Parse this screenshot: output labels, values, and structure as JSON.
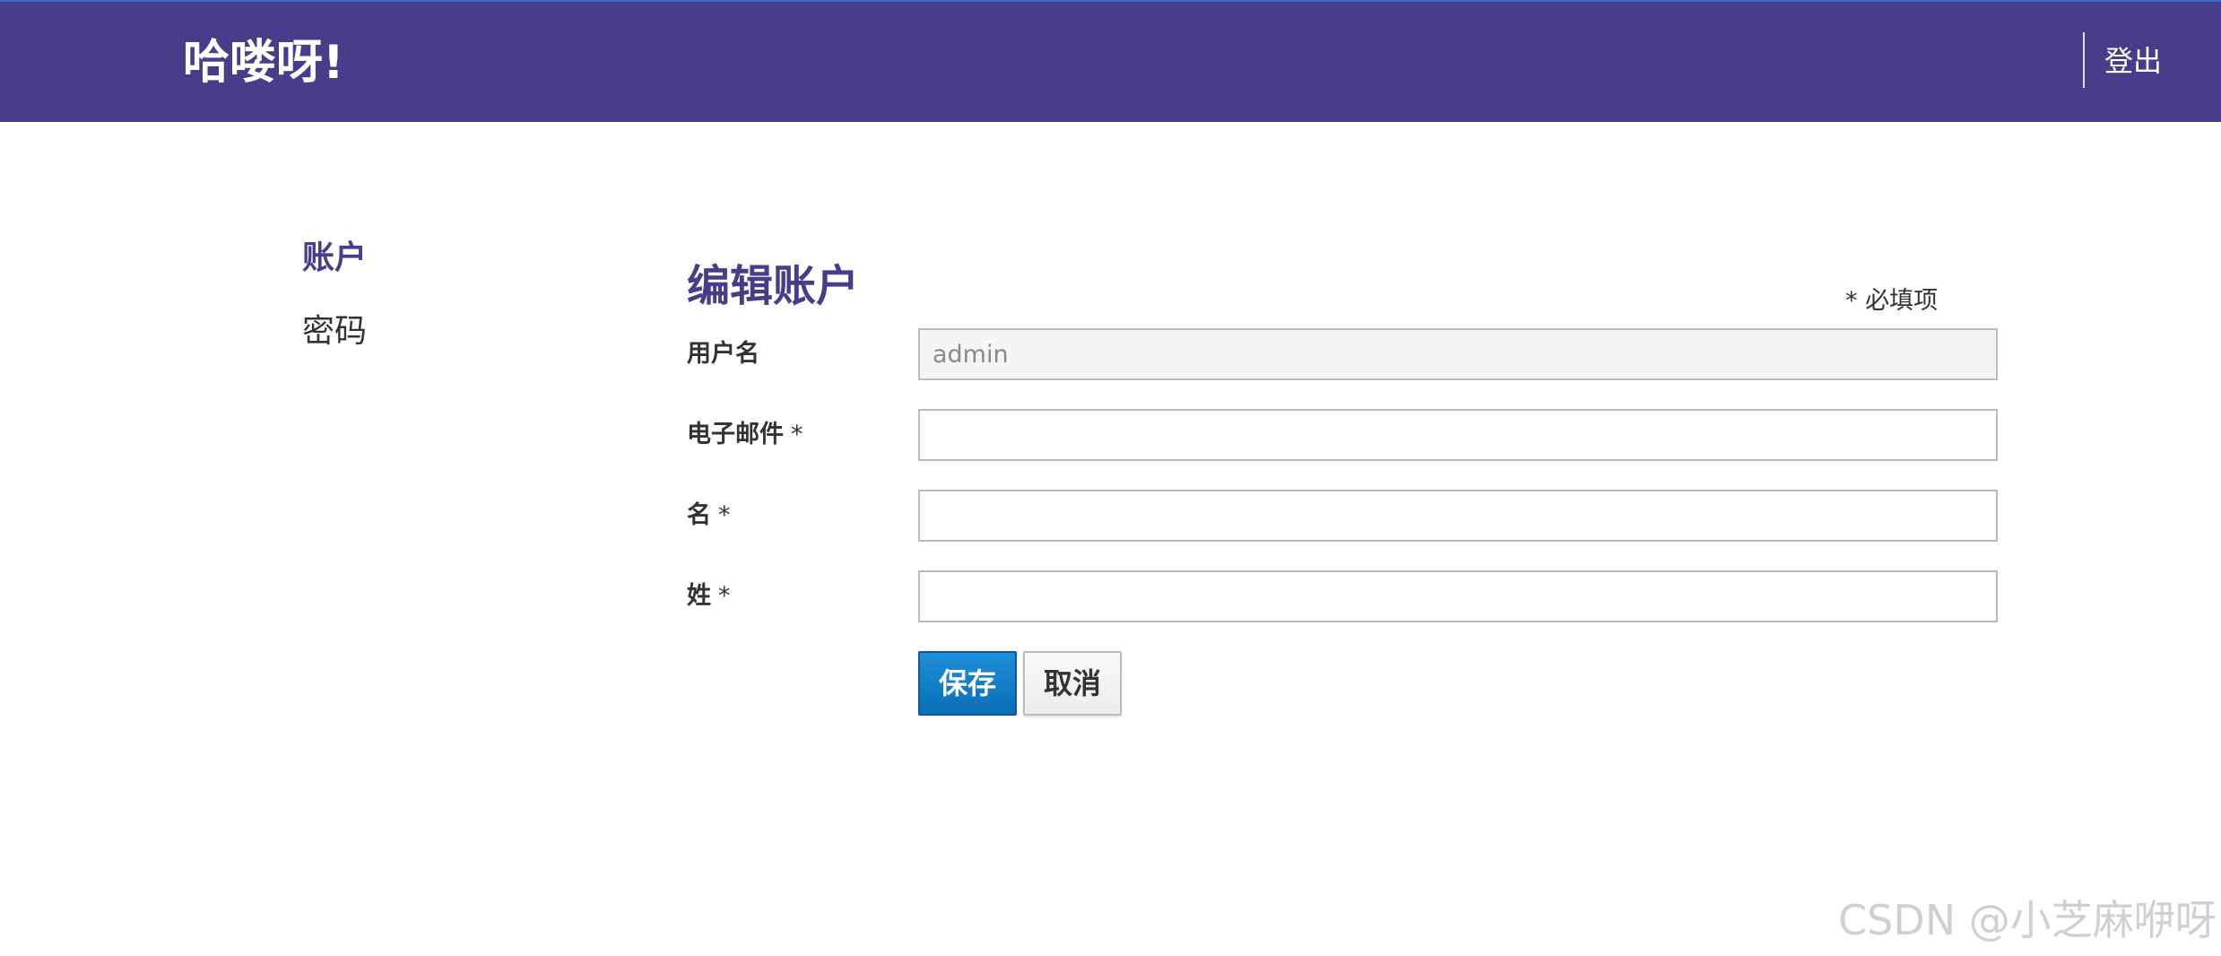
{
  "header": {
    "brand": "哈喽呀!",
    "logout_label": "登出"
  },
  "sidebar": {
    "items": [
      {
        "label": "账户",
        "active": true
      },
      {
        "label": "密码",
        "active": false
      }
    ]
  },
  "form": {
    "title": "编辑账户",
    "required_note": "* 必填项",
    "fields": [
      {
        "label": "用户名",
        "required": false,
        "value": "admin",
        "readonly": true
      },
      {
        "label": "电子邮件",
        "required": true,
        "value": "",
        "readonly": false
      },
      {
        "label": "名",
        "required": true,
        "value": "",
        "readonly": false
      },
      {
        "label": "姓",
        "required": true,
        "value": "",
        "readonly": false
      }
    ],
    "required_marker": "*",
    "save_label": "保存",
    "cancel_label": "取消"
  },
  "watermark": "CSDN @小芝麻咿呀",
  "colors": {
    "brand_purple": "#483c8b",
    "primary_blue": "#0a6fb7"
  }
}
